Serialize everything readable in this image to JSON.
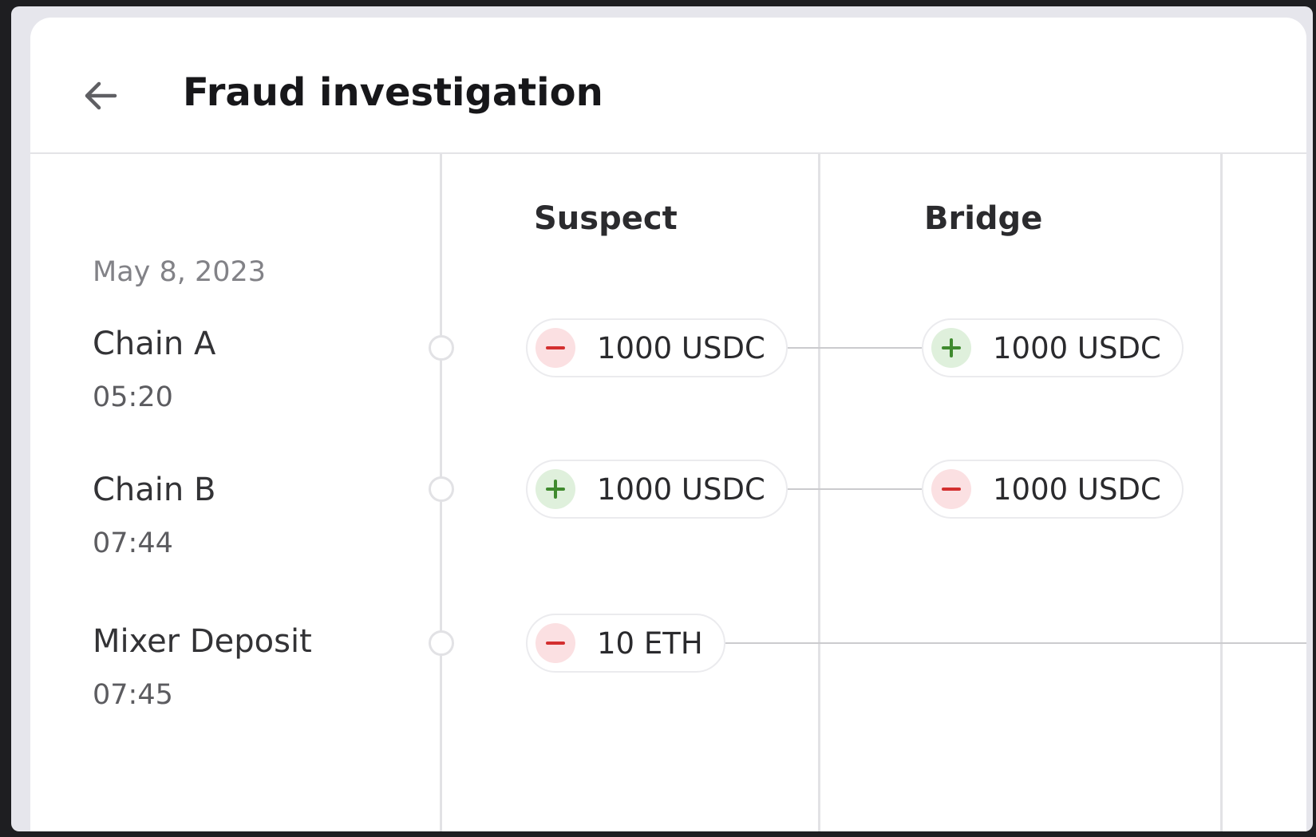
{
  "header": {
    "title": "Fraud investigation",
    "back_icon": "arrow-left-icon"
  },
  "columns": [
    {
      "label": "Suspect"
    },
    {
      "label": "Bridge"
    }
  ],
  "timeline": {
    "date": "May 8, 2023",
    "events": [
      {
        "name": "Chain A",
        "time": "05:20"
      },
      {
        "name": "Chain B",
        "time": "07:44"
      },
      {
        "name": "Mixer Deposit",
        "time": "07:45"
      }
    ]
  },
  "transfers": {
    "chain_a_suspect": {
      "amount": "1000 USDC",
      "direction": "out",
      "icon": "minus-icon"
    },
    "chain_a_bridge": {
      "amount": "1000 USDC",
      "direction": "in",
      "icon": "plus-icon"
    },
    "chain_b_suspect": {
      "amount": "1000 USDC",
      "direction": "in",
      "icon": "plus-icon"
    },
    "chain_b_bridge": {
      "amount": "1000 USDC",
      "direction": "out",
      "icon": "minus-icon"
    },
    "mixer_suspect": {
      "amount": "10 ETH",
      "direction": "out",
      "icon": "minus-icon"
    }
  },
  "colors": {
    "outflow": "#d32f2f",
    "outflow_bg": "#fbe0e2",
    "inflow": "#3f8a2e",
    "inflow_bg": "#dff0dc"
  }
}
